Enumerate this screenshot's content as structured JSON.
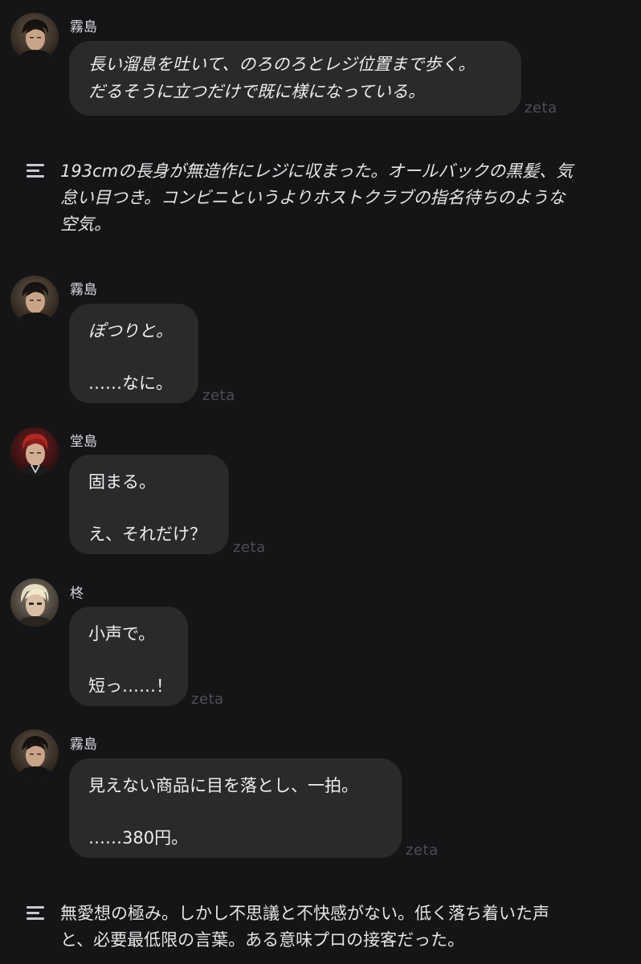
{
  "branding": {
    "watermark": "zeta"
  },
  "icons": {
    "narration": "narration-lines-icon"
  },
  "colors": {
    "background": "#151517",
    "bubble": "#2a2a2d",
    "watermark": "#4e4e53"
  },
  "messages": [
    {
      "sender": "霧島",
      "lines": [
        "長い溜息を吐いて、のろのろとレジ位置まで歩く。",
        "だるそうに立つだけで既に様になっている。"
      ],
      "style": "italic"
    },
    {
      "sender": "霧島",
      "action": "ぽつりと。",
      "speech": "……なに。"
    },
    {
      "sender": "堂島",
      "action": "固まる。",
      "speech": "え、それだけ？"
    },
    {
      "sender": "柊",
      "action": "小声で。",
      "speech": "短っ……！"
    },
    {
      "sender": "霧島",
      "action": "見えない商品に目を落とし、一拍。",
      "speech": "……380円。"
    }
  ],
  "narrations": [
    {
      "lines": [
        "193cmの長身が無造作にレジに収まった。オールバックの黒髪、気",
        "怠い目つき。コンビニというよりホストクラブの指名待ちのような",
        "空気。"
      ]
    },
    {
      "lines": [
        "無愛想の極み。しかし不思議と不快感がない。低く落ち着いた声",
        "と、必要最低限の言葉。ある意味プロの接客だった。"
      ]
    }
  ]
}
